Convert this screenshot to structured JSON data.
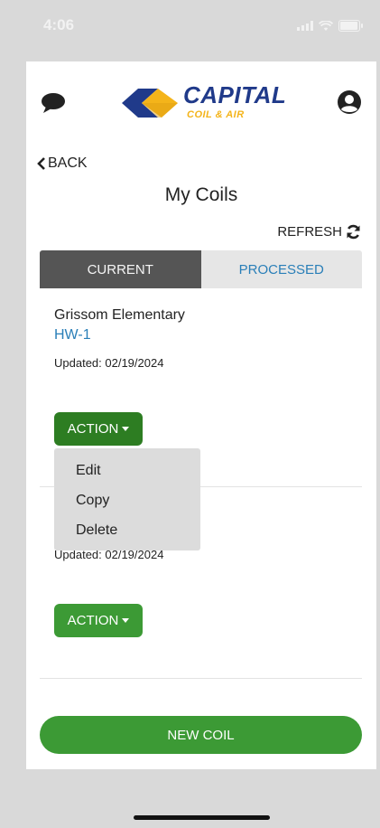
{
  "status": {
    "time": "4:06"
  },
  "header": {
    "brand": "CAPITAL",
    "brand_sub": "COIL & AIR",
    "brand_colors": {
      "navy": "#203a8a",
      "gold": "#f4b41a"
    }
  },
  "nav": {
    "back_label": "BACK"
  },
  "page": {
    "title": "My Coils",
    "refresh_label": "REFRESH"
  },
  "tabs": [
    {
      "label": "CURRENT",
      "active": true
    },
    {
      "label": "PROCESSED",
      "active": false
    }
  ],
  "coils": [
    {
      "name": "Grissom Elementary",
      "code": "HW-1",
      "updated": "Updated: 02/19/2024",
      "action_label": "ACTION"
    },
    {
      "name": "",
      "code": "",
      "updated": "Updated: 02/19/2024",
      "action_label": "ACTION"
    }
  ],
  "dropdown": {
    "options": [
      "Edit",
      "Copy",
      "Delete"
    ]
  },
  "footer": {
    "new_coil_label": "NEW COIL"
  },
  "colors": {
    "action_active": "#2d7d22",
    "action_normal": "#3c9a35",
    "tab_active_bg": "#555555",
    "tab_inactive_bg": "#e6e6e6",
    "link_blue": "#2a7fb8"
  }
}
